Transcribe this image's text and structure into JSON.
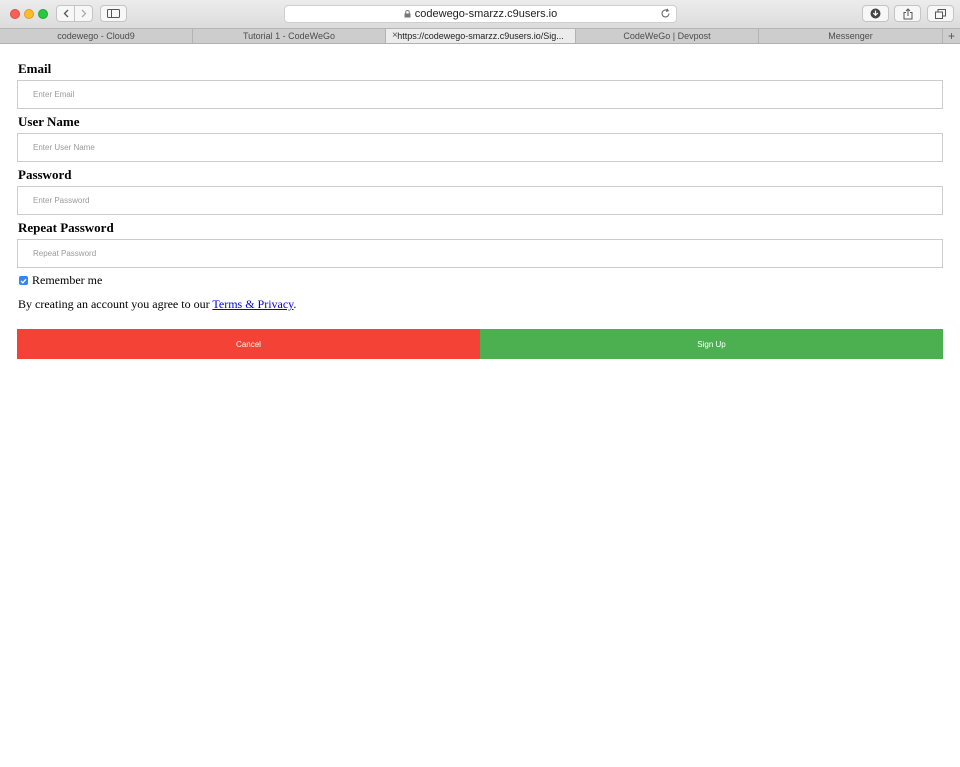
{
  "browser": {
    "url": "codewego-smarzz.c9users.io",
    "tabs": [
      {
        "label": "codewego - Cloud9"
      },
      {
        "label": "Tutorial 1 - CodeWeGo"
      },
      {
        "label": "https://codewego-smarzz.c9users.io/Sig..."
      },
      {
        "label": "CodeWeGo | Devpost"
      },
      {
        "label": "Messenger"
      }
    ],
    "active_tab": 2
  },
  "form": {
    "email": {
      "label": "Email",
      "placeholder": "Enter Email",
      "value": ""
    },
    "username": {
      "label": "User Name",
      "placeholder": "Enter User Name",
      "value": ""
    },
    "password": {
      "label": "Password",
      "placeholder": "Enter Password",
      "value": ""
    },
    "repeat_password": {
      "label": "Repeat Password",
      "placeholder": "Repeat Password",
      "value": ""
    },
    "remember": {
      "label": "Remember me",
      "checked": true
    },
    "terms": {
      "prefix": "By creating an account you agree to our ",
      "link": "Terms & Privacy",
      "suffix": "."
    },
    "cancel_label": "Cancel",
    "signup_label": "Sign Up"
  },
  "colors": {
    "cancel": "#f44336",
    "signup": "#4caf50",
    "checkbox": "#3b82f6",
    "link": "#0000ee"
  }
}
